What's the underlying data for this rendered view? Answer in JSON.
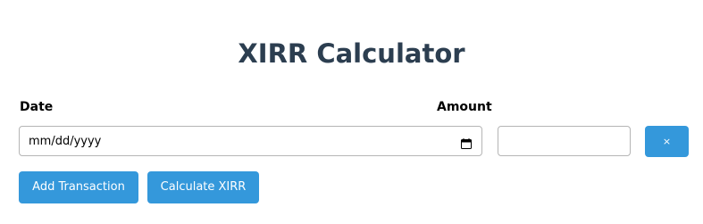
{
  "page": {
    "title": "XIRR Calculator"
  },
  "form": {
    "date_label": "Date",
    "amount_label": "Amount",
    "date_placeholder": "mm/dd/yyyy",
    "amount_value": "",
    "remove_label": "×",
    "calendar_icon": "calendar-icon"
  },
  "actions": {
    "add_label": "Add Transaction",
    "calculate_label": "Calculate XIRR"
  },
  "colors": {
    "accent": "#3498db",
    "title": "#2c3e50",
    "border": "#b5b5b5"
  }
}
